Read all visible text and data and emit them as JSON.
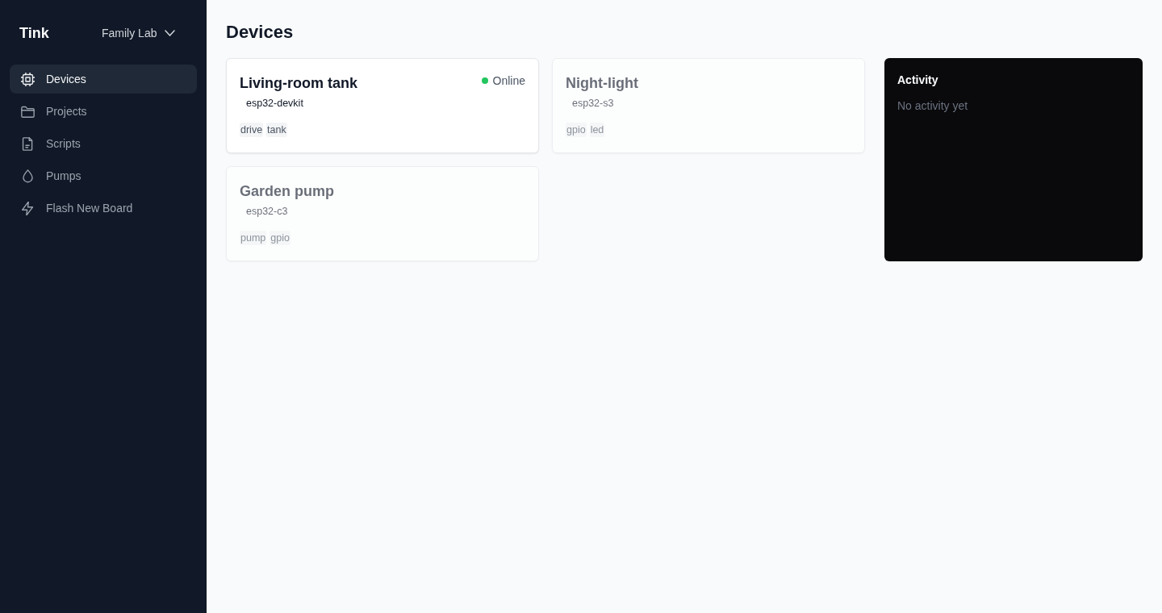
{
  "sidebar": {
    "brand": "Tink",
    "workspace": "Family Lab",
    "items": [
      {
        "label": "Devices",
        "kind": "chip",
        "selected": true
      },
      {
        "label": "Projects",
        "kind": "folder",
        "selected": false
      },
      {
        "label": "Scripts",
        "kind": "file",
        "selected": false
      },
      {
        "label": "Pumps",
        "kind": "drop",
        "selected": false
      },
      {
        "label": "Flash New Board",
        "kind": "bolt",
        "selected": false
      }
    ]
  },
  "page": {
    "title": "Devices"
  },
  "devices": [
    {
      "name": "Living-room tank",
      "board": "esp32-devkit",
      "online": true,
      "status": "Online",
      "tags": [
        "drive",
        "tank"
      ]
    },
    {
      "name": "Night-light",
      "board": "esp32-s3",
      "online": false,
      "tags": [
        "gpio",
        "led"
      ]
    },
    {
      "name": "Garden pump",
      "board": "esp32-c3",
      "online": false,
      "tags": [
        "pump",
        "gpio"
      ]
    }
  ],
  "activity": {
    "title": "Activity",
    "empty_text": "No activity yet"
  }
}
